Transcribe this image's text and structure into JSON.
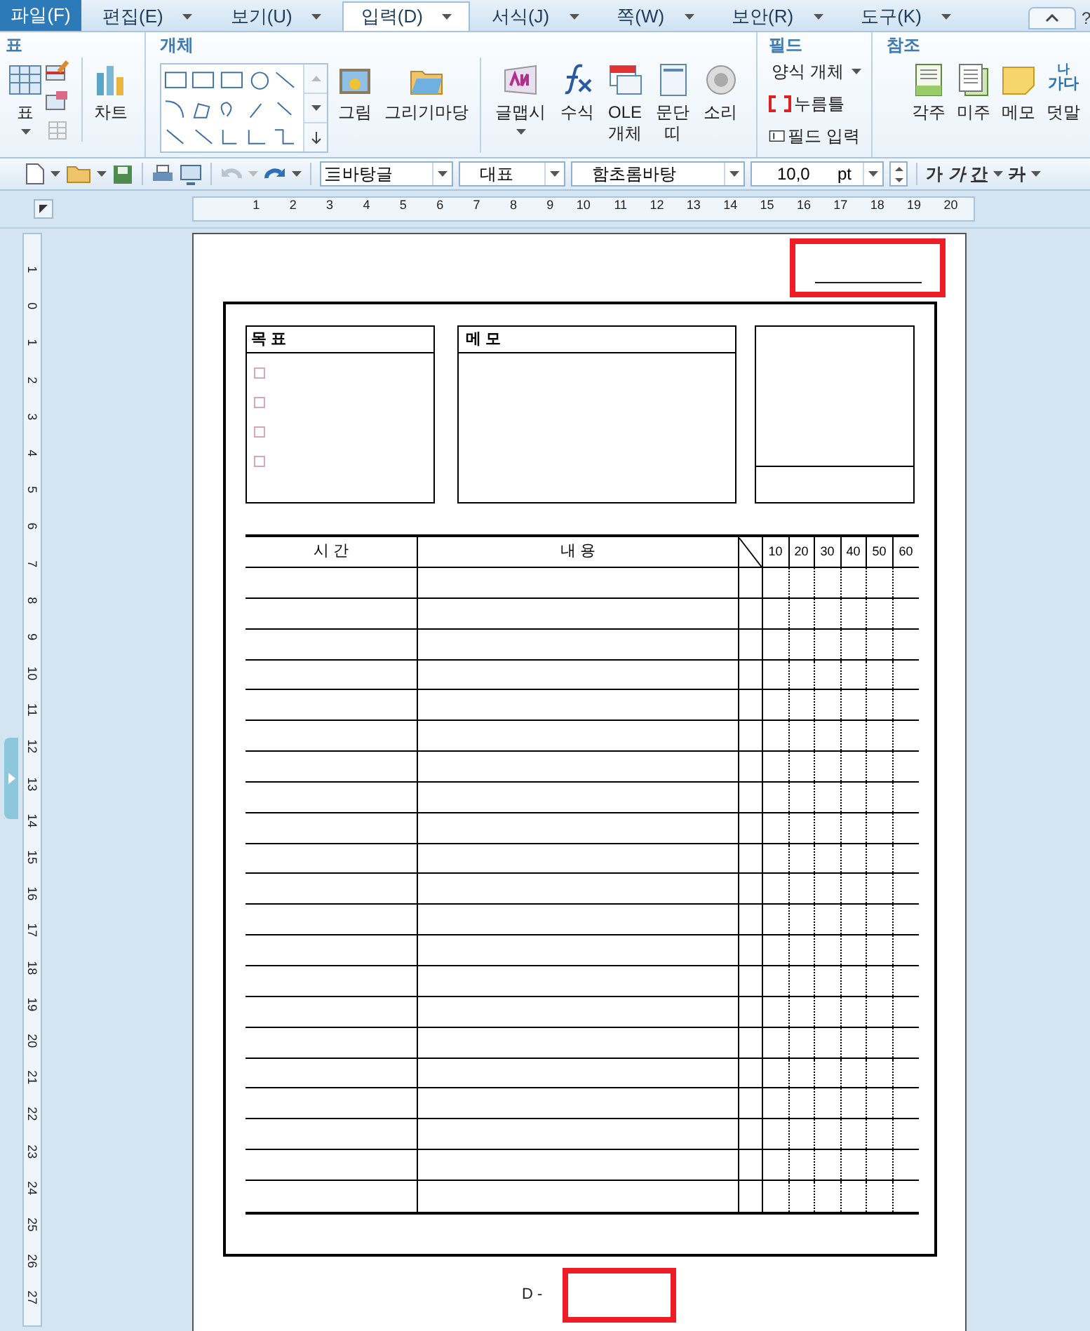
{
  "menu_tabs": [
    {
      "label": "파일(F)",
      "kind": "file",
      "selected": false
    },
    {
      "label": "편집(E)",
      "kind": "menu",
      "selected": false
    },
    {
      "label": "보기(U)",
      "kind": "menu",
      "selected": false
    },
    {
      "label": "입력(D)",
      "kind": "menu",
      "selected": true
    },
    {
      "label": "서식(J)",
      "kind": "menu",
      "selected": false
    },
    {
      "label": "쪽(W)",
      "kind": "menu",
      "selected": false
    },
    {
      "label": "보안(R)",
      "kind": "menu",
      "selected": false
    },
    {
      "label": "도구(K)",
      "kind": "menu",
      "selected": false
    }
  ],
  "help": "?",
  "ribbon": {
    "groups": [
      {
        "title": "표",
        "buttons": [
          {
            "lines": [
              "표"
            ],
            "kind": "table",
            "dropdown": true
          },
          {
            "lines": [
              "차트"
            ],
            "kind": "chart",
            "dropdown": false
          }
        ]
      },
      {
        "title": "개체",
        "buttons": [
          {
            "lines": [
              "그림"
            ],
            "kind": "picture",
            "dropdown": false
          },
          {
            "lines": [
              "그리기마당"
            ],
            "kind": "clipart",
            "dropdown": false
          },
          {
            "lines": [
              "글맵시"
            ],
            "kind": "wordart",
            "dropdown": true
          },
          {
            "lines": [
              "수식"
            ],
            "kind": "formula",
            "dropdown": false
          },
          {
            "lines": [
              "OLE",
              "개체"
            ],
            "kind": "ole",
            "dropdown": false
          },
          {
            "lines": [
              "문단",
              "띠"
            ],
            "kind": "band",
            "dropdown": false
          },
          {
            "lines": [
              "소리"
            ],
            "kind": "sound",
            "dropdown": false
          }
        ]
      },
      {
        "title": "필드",
        "buttons": [
          {
            "lines": [
              "양식 개체"
            ],
            "kind": "form",
            "dropdown": true
          },
          {
            "lines": [
              "누름틀"
            ],
            "kind": "clickhere",
            "dropdown": false
          },
          {
            "lines": [
              "필드 입력"
            ],
            "kind": "field",
            "dropdown": false
          }
        ]
      },
      {
        "title": "참조",
        "buttons": [
          {
            "lines": [
              "각주"
            ],
            "kind": "footnote",
            "dropdown": false
          },
          {
            "lines": [
              "미주"
            ],
            "kind": "endnote",
            "dropdown": false
          },
          {
            "lines": [
              "메모"
            ],
            "kind": "memo",
            "dropdown": false
          },
          {
            "lines": [
              "덧말"
            ],
            "kind": "ruby",
            "dropdown": false,
            "badge_top": "나",
            "badge_bottom": "가다"
          }
        ]
      }
    ]
  },
  "toolbar": {
    "undo": {
      "disabled": true
    },
    "style": "바탕글",
    "language": "대표",
    "font": "함초롬바탕",
    "size": "10,0",
    "unit": "pt",
    "format_buttons": [
      {
        "label": "가",
        "kind": "bold"
      },
      {
        "label": "가",
        "kind": "italic"
      },
      {
        "label": "간",
        "kind": "underline"
      },
      {
        "label": "가",
        "kind": "strike"
      }
    ]
  },
  "horizontal_ruler": {
    "labels": [
      "1",
      "2",
      "3",
      "4",
      "5",
      "6",
      "7",
      "8",
      "9",
      "10",
      "11",
      "12",
      "13",
      "14",
      "15",
      "16",
      "17",
      "18",
      "19",
      "20"
    ]
  },
  "vertical_ruler": {
    "labels": [
      "1",
      "0",
      "1",
      "2",
      "3",
      "4",
      "5",
      "6",
      "7",
      "8",
      "9",
      "10",
      "11",
      "12",
      "13",
      "14",
      "15",
      "16",
      "17",
      "18",
      "19",
      "20",
      "21",
      "22",
      "23",
      "24",
      "25",
      "26",
      "27"
    ]
  },
  "document": {
    "goals": {
      "title": "목 표",
      "items": [
        {
          "checked": false
        },
        {
          "checked": false
        },
        {
          "checked": false
        },
        {
          "checked": false
        }
      ]
    },
    "memo": {
      "title": "메 모"
    },
    "schedule": {
      "columns": [
        "시 간",
        "내 용"
      ],
      "minute_columns": [
        "10",
        "20",
        "30",
        "40",
        "50",
        "60"
      ]
    },
    "d_day": {
      "prefix": "D -"
    }
  }
}
